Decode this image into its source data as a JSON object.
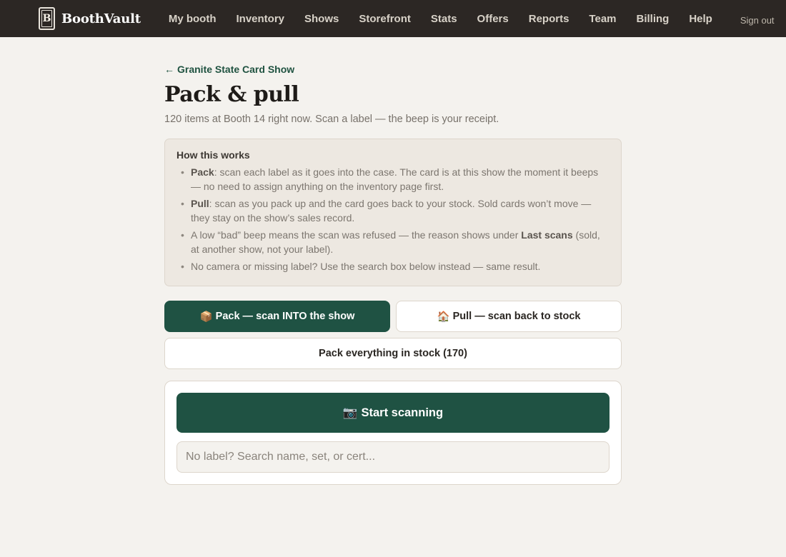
{
  "brand": {
    "name": "BoothVault",
    "logo_letter": "B"
  },
  "nav": {
    "items": [
      "My booth",
      "Inventory",
      "Shows",
      "Storefront",
      "Stats",
      "Offers",
      "Reports",
      "Team",
      "Billing",
      "Help"
    ],
    "signout": "Sign out"
  },
  "page": {
    "back_arrow": "←",
    "back_label": "Granite State Card Show",
    "title": "Pack & pull",
    "subtitle": "120 items at Booth 14 right now. Scan a label — the beep is your receipt."
  },
  "howto": {
    "title": "How this works",
    "items": [
      {
        "bold": "Pack",
        "text": ": scan each label as it goes into the case. The card is at this show the moment it beeps — no need to assign anything on the inventory page first.",
        "bold2": "",
        "text2": ""
      },
      {
        "bold": "Pull",
        "text": ": scan as you pack up and the card goes back to your stock. Sold cards won’t move — they stay on the show’s sales record.",
        "bold2": "",
        "text2": ""
      },
      {
        "bold": "",
        "text": "A low “bad” beep means the scan was refused — the reason shows under ",
        "bold2": "Last scans",
        "text2": " (sold, at another show, not your label)."
      },
      {
        "bold": "",
        "text": "No camera or missing label? Use the search box below instead — same result.",
        "bold2": "",
        "text2": ""
      }
    ]
  },
  "actions": {
    "pack_icon": "📦",
    "pack_label": "Pack — scan INTO the show",
    "pull_icon": "🏠",
    "pull_label": "Pull — scan back to stock",
    "pack_all_label": "Pack everything in stock (170)",
    "scan_icon": "📷",
    "scan_label": "Start scanning"
  },
  "search": {
    "placeholder": "No label? Search name, set, or cert..."
  },
  "colors": {
    "topbar": "#2c2724",
    "accent": "#1f5243",
    "background": "#f4f2ee"
  }
}
